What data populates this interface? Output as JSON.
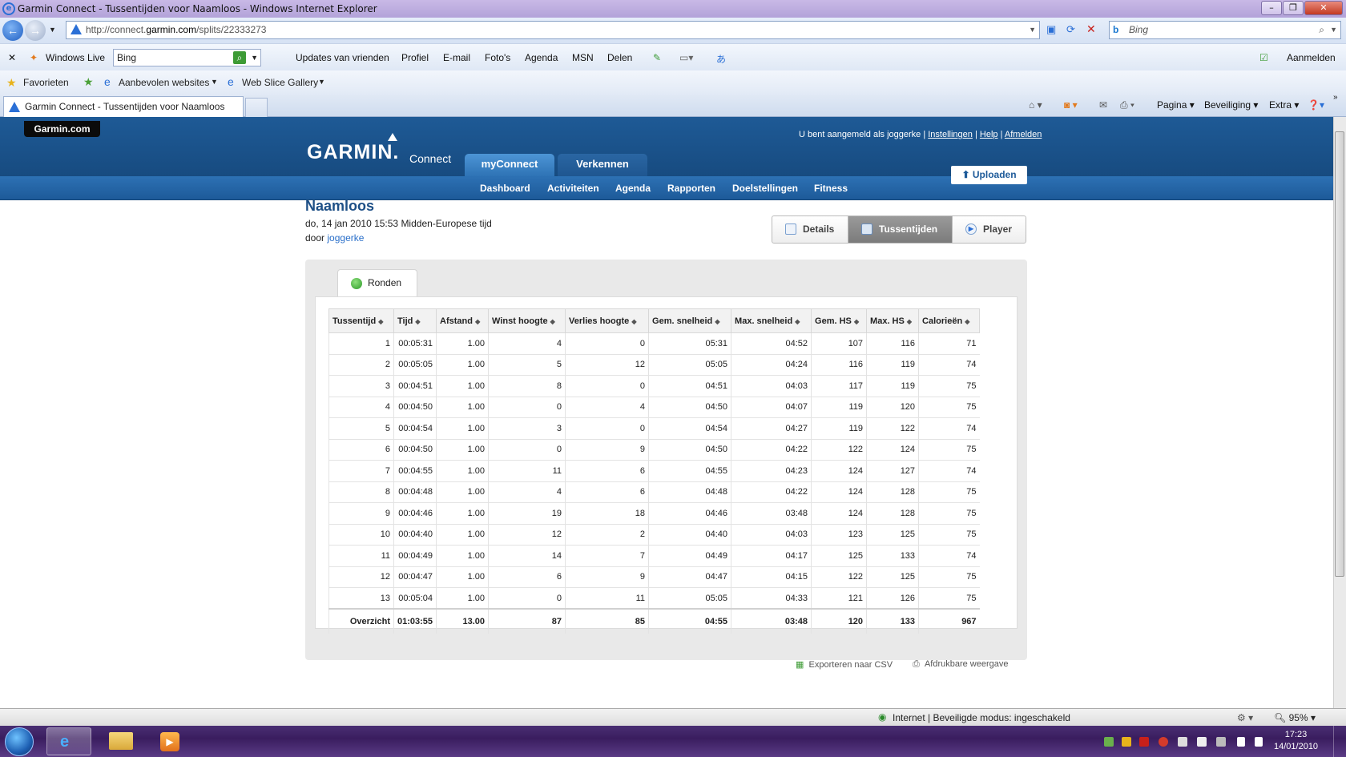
{
  "browser": {
    "window_title": "Garmin Connect - Tussentijden voor Naamloos - Windows Internet Explorer",
    "address_prefix": "http://connect.",
    "address_domain": "garmin.com",
    "address_path": "/splits/22333273",
    "search_engine": "Bing",
    "live_toolbar": {
      "brand": "Windows Live",
      "search_value": "Bing",
      "links": [
        "Updates van vrienden",
        "Profiel",
        "E-mail",
        "Foto's",
        "Agenda",
        "MSN",
        "Delen"
      ],
      "signin": "Aanmelden"
    },
    "favorites": {
      "label": "Favorieten",
      "suggested": "Aanbevolen websites",
      "slice": "Web Slice Gallery"
    },
    "tab_title": "Garmin Connect - Tussentijden voor Naamloos",
    "commands": {
      "page": "Pagina",
      "safety": "Beveiliging",
      "extra": "Extra"
    },
    "status": {
      "zone": "Internet | Beveiligde modus: ingeschakeld",
      "zoom": "95%"
    }
  },
  "garmin": {
    "site_link": "Garmin.com",
    "logo_text": "GARMIN.",
    "logo_sub": "Connect",
    "user_prefix": "U bent aangemeld als joggerke",
    "user_links": {
      "settings": "Instellingen",
      "help": "Help",
      "logout": "Afmelden"
    },
    "top_tabs": {
      "my": "myConnect",
      "explore": "Verkennen"
    },
    "nav": [
      "Dashboard",
      "Activiteiten",
      "Agenda",
      "Rapporten",
      "Doelstellingen",
      "Fitness"
    ],
    "upload": "Uploaden"
  },
  "activity": {
    "title": "Naamloos",
    "date": "do, 14 jan 2010 15:53 Midden-Europese tijd",
    "by_prefix": "door",
    "user": "joggerke",
    "view_tabs": {
      "details": "Details",
      "splits": "Tussentijden",
      "player": "Player"
    },
    "laps_tab": "Ronden"
  },
  "table": {
    "headers": [
      "Tussentijd",
      "Tijd",
      "Afstand",
      "Winst hoogte",
      "Verlies hoogte",
      "Gem. snelheid",
      "Max. snelheid",
      "Gem. HS",
      "Max. HS",
      "Calorieën"
    ],
    "rows": [
      [
        "1",
        "00:05:31",
        "1.00",
        "4",
        "0",
        "05:31",
        "04:52",
        "107",
        "116",
        "71"
      ],
      [
        "2",
        "00:05:05",
        "1.00",
        "5",
        "12",
        "05:05",
        "04:24",
        "116",
        "119",
        "74"
      ],
      [
        "3",
        "00:04:51",
        "1.00",
        "8",
        "0",
        "04:51",
        "04:03",
        "117",
        "119",
        "75"
      ],
      [
        "4",
        "00:04:50",
        "1.00",
        "0",
        "4",
        "04:50",
        "04:07",
        "119",
        "120",
        "75"
      ],
      [
        "5",
        "00:04:54",
        "1.00",
        "3",
        "0",
        "04:54",
        "04:27",
        "119",
        "122",
        "74"
      ],
      [
        "6",
        "00:04:50",
        "1.00",
        "0",
        "9",
        "04:50",
        "04:22",
        "122",
        "124",
        "75"
      ],
      [
        "7",
        "00:04:55",
        "1.00",
        "11",
        "6",
        "04:55",
        "04:23",
        "124",
        "127",
        "74"
      ],
      [
        "8",
        "00:04:48",
        "1.00",
        "4",
        "6",
        "04:48",
        "04:22",
        "124",
        "128",
        "75"
      ],
      [
        "9",
        "00:04:46",
        "1.00",
        "19",
        "18",
        "04:46",
        "03:48",
        "124",
        "128",
        "75"
      ],
      [
        "10",
        "00:04:40",
        "1.00",
        "12",
        "2",
        "04:40",
        "04:03",
        "123",
        "125",
        "75"
      ],
      [
        "11",
        "00:04:49",
        "1.00",
        "14",
        "7",
        "04:49",
        "04:17",
        "125",
        "133",
        "74"
      ],
      [
        "12",
        "00:04:47",
        "1.00",
        "6",
        "9",
        "04:47",
        "04:15",
        "122",
        "125",
        "75"
      ],
      [
        "13",
        "00:05:04",
        "1.00",
        "0",
        "11",
        "05:05",
        "04:33",
        "121",
        "126",
        "75"
      ]
    ],
    "summary": [
      "Overzicht",
      "01:03:55",
      "13.00",
      "87",
      "85",
      "04:55",
      "03:48",
      "120",
      "133",
      "967"
    ]
  },
  "footer_links": {
    "csv": "Exporteren naar CSV",
    "print": "Afdrukbare weergave"
  },
  "taskbar": {
    "time": "17:23",
    "date": "14/01/2010"
  }
}
